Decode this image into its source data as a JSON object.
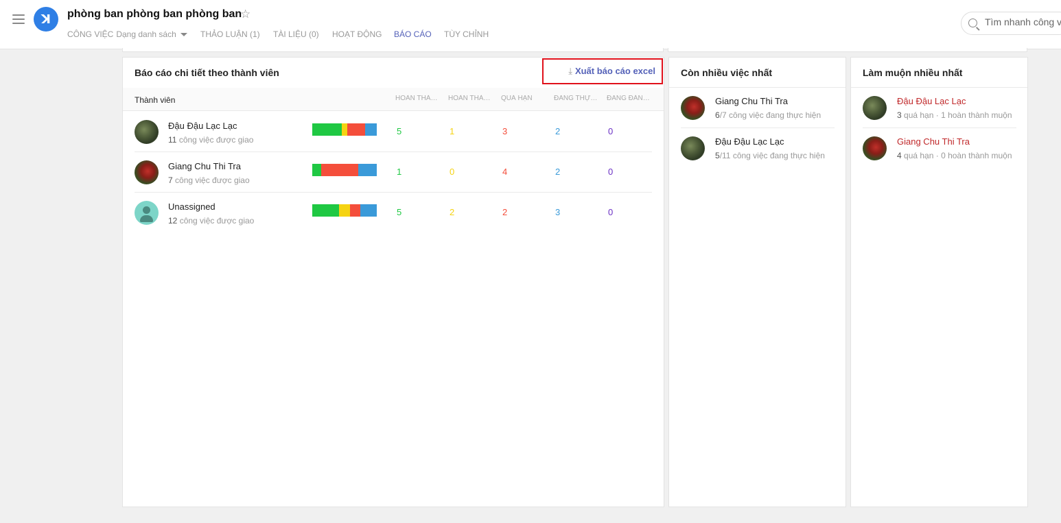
{
  "project": {
    "title": "phòng ban phòng ban phòng ban"
  },
  "tabs": [
    {
      "label": "CÔNG VIỆC",
      "sub": "Dạng danh sách"
    },
    {
      "label": "THẢO LUẬN (1)"
    },
    {
      "label": "TÀI LIỆU (0)"
    },
    {
      "label": "HOẠT ĐỘNG"
    },
    {
      "label": "BÁO CÁO"
    },
    {
      "label": "TÙY CHỈNH"
    }
  ],
  "search": {
    "placeholder": "Tìm nhanh công việc"
  },
  "report": {
    "title": "Báo cáo chi tiết theo thành viên",
    "export_label": "Xuất báo cáo excel",
    "member_header": "Thành viên",
    "columns": [
      "HOÀN THÀNH",
      "HOÀN THÀNH MUỘN",
      "QUÁ HẠN",
      "ĐANG THỰC HIỆN",
      "ĐANG ĐÁNH GIÁ"
    ],
    "colors": {
      "done": "#1fc843",
      "late": "#f5d312",
      "overdue": "#f44e3b",
      "doing": "#3a9ad9",
      "review": "#6a2fc4"
    },
    "members": [
      {
        "name": "Đậu Đậu Lạc Lạc",
        "count": "11",
        "assigned_text": "công việc được giao",
        "values": [
          5,
          1,
          3,
          2,
          0
        ]
      },
      {
        "name": "Giang Chu Thi Tra",
        "count": "7",
        "assigned_text": "công việc được giao",
        "values": [
          1,
          0,
          4,
          2,
          0
        ]
      },
      {
        "name": "Unassigned",
        "count": "12",
        "assigned_text": "công việc được giao",
        "values": [
          5,
          2,
          2,
          3,
          0
        ]
      }
    ]
  },
  "most_work": {
    "title": "Còn nhiều việc nhất",
    "items": [
      {
        "name": "Giang Chu Thi Tra",
        "count": "6",
        "rest": "/7 công việc đang thực hiện"
      },
      {
        "name": "Đậu Đậu Lạc Lạc",
        "count": "5",
        "rest": "/11 công việc đang thực hiện"
      }
    ]
  },
  "most_late": {
    "title": "Làm muộn nhiều nhất",
    "items": [
      {
        "name": "Đậu Đậu Lạc Lạc",
        "count": "3",
        "rest": "quá hạn · 1 hoàn thành muộn"
      },
      {
        "name": "Giang Chu Thi Tra",
        "count": "4",
        "rest": "quá hạn · 0 hoàn thành muộn"
      }
    ]
  }
}
